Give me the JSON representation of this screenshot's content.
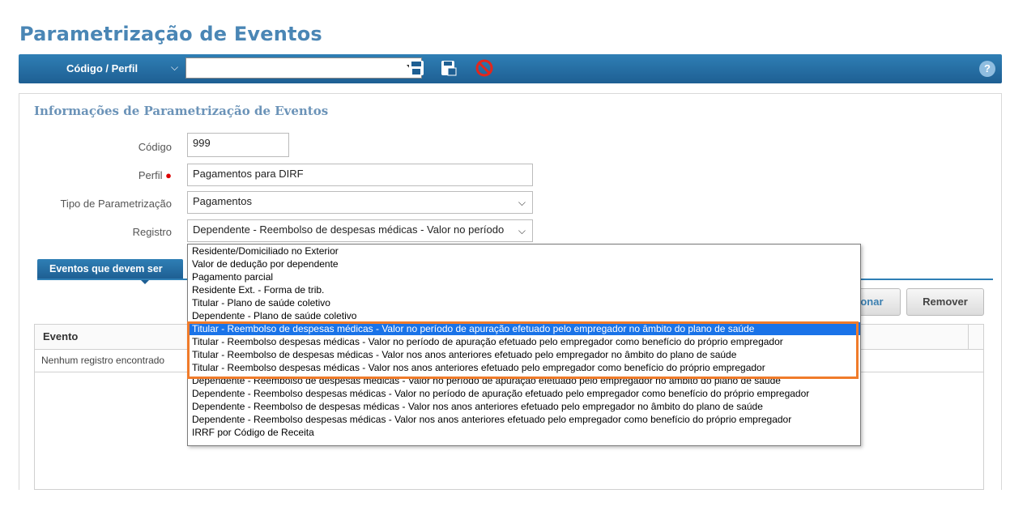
{
  "page_title": "Parametrização de Eventos",
  "toolbar": {
    "label": "Código / Perfil",
    "combo_value": "",
    "help_label": "?"
  },
  "form": {
    "section_title": "Informações de Parametrização de Eventos",
    "codigo_label": "Código",
    "codigo_value": "999",
    "perfil_label": "Perfil",
    "perfil_value": "Pagamentos para DIRF",
    "tipo_label": "Tipo de Parametrização",
    "tipo_value": "Pagamentos",
    "registro_label": "Registro",
    "registro_value": "Dependente - Reembolso de despesas médicas - Valor no período"
  },
  "tab": {
    "label": "Eventos que devem ser"
  },
  "buttons": {
    "add_label": "cionar",
    "remove_label": "Remover"
  },
  "grid": {
    "column_evento": "Evento",
    "empty_text": "Nenhum registro encontrado"
  },
  "dropdown": {
    "options": [
      "Residente/Domiciliado no Exterior",
      "Valor de dedução por dependente",
      "Pagamento parcial",
      "Residente Ext. - Forma de trib.",
      "Titular - Plano de saúde coletivo",
      "Dependente - Plano de saúde coletivo",
      "Titular - Reembolso de despesas médicas - Valor no período de apuração efetuado pelo empregador no âmbito do plano de saúde",
      "Titular - Reembolso despesas médicas - Valor no período de apuração efetuado pelo empregador como benefício do próprio empregador",
      "Titular - Reembolso de despesas médicas - Valor nos anos anteriores efetuado pelo empregador no âmbito do plano de saúde",
      "Titular - Reembolso despesas médicas - Valor nos anos anteriores efetuado pelo empregador como benefício do próprio empregador",
      "Dependente - Reembolso de despesas médicas - Valor no período de apuração efetuado pelo empregador no âmbito do plano de saúde",
      "Dependente - Reembolso despesas médicas - Valor no período de apuração efetuado pelo empregador como benefício do próprio empregador",
      "Dependente - Reembolso de despesas médicas - Valor nos anos anteriores efetuado pelo empregador no âmbito do plano de saúde",
      "Dependente - Reembolso despesas médicas - Valor nos anos anteriores efetuado pelo empregador como benefício do próprio empregador",
      "IRRF por Código de Receita"
    ],
    "selected_index": 6
  },
  "icons": {
    "save": "floppy-disk-icon",
    "save_as": "save-as-icon",
    "cancel": "cancel-icon",
    "help": "help-icon"
  },
  "colors": {
    "accent": "#2f7fb5",
    "title": "#4a86b5",
    "selection": "#1a73e8",
    "highlight_border": "#f07b2a"
  }
}
